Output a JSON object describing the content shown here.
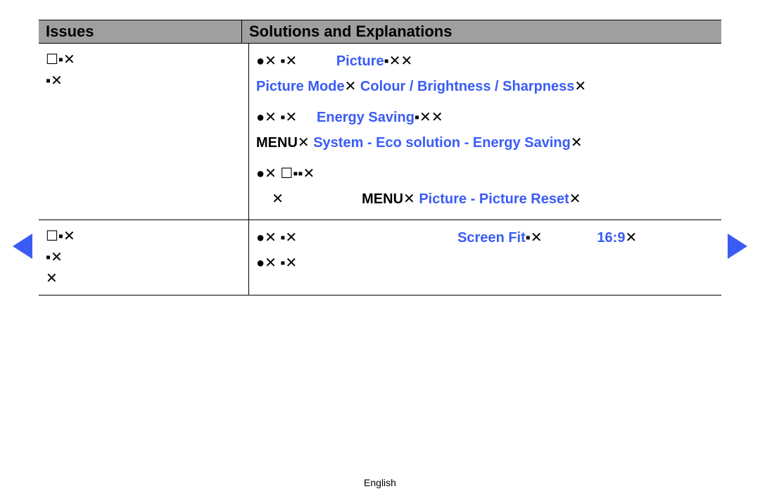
{
  "header": {
    "issues": "Issues",
    "solutions": "Solutions and Explanations"
  },
  "row1": {
    "issue_l1": "☐▪✕",
    "issue_l2": "▪✕",
    "sol_b1_prefix": "●✕ ▪✕          ",
    "sol_b1_picture": "Picture",
    "sol_b1_suffix": "▪✕✕",
    "sol_b1_line2_mode": "Picture Mode",
    "sol_b1_line2_mid": "✕ ",
    "sol_b1_line2_cbs": "Colour / Brightness / Sharpness",
    "sol_b1_line2_end": "✕",
    "sol_b2_prefix": "●✕ ▪✕     ",
    "sol_b2_energy": "Energy Saving",
    "sol_b2_suffix": "▪✕✕",
    "sol_b2_line2_menu": "MENU",
    "sol_b2_line2_mid": "✕ ",
    "sol_b2_line2_path": "System - Eco solution - Energy Saving",
    "sol_b2_line2_end": "✕",
    "sol_b3_line1": "●✕ ☐▪▪✕",
    "sol_b3_line2_pad": "    ✕                    ",
    "sol_b3_line2_menu": "MENU",
    "sol_b3_line2_mid": "✕ ",
    "sol_b3_line2_path": "Picture - Picture Reset",
    "sol_b3_line2_end": "✕"
  },
  "row2": {
    "issue_l1": "☐▪✕",
    "issue_l2": "▪✕",
    "issue_l3": "✕",
    "sol_b1_prefix": "●✕ ▪✕                                         ",
    "sol_b1_screenfit": "Screen Fit",
    "sol_b1_mid": "▪✕              ",
    "sol_b1_169": "16:9",
    "sol_b1_end": "✕",
    "sol_b2": "●✕ ▪✕"
  },
  "footer": {
    "lang": "English"
  }
}
